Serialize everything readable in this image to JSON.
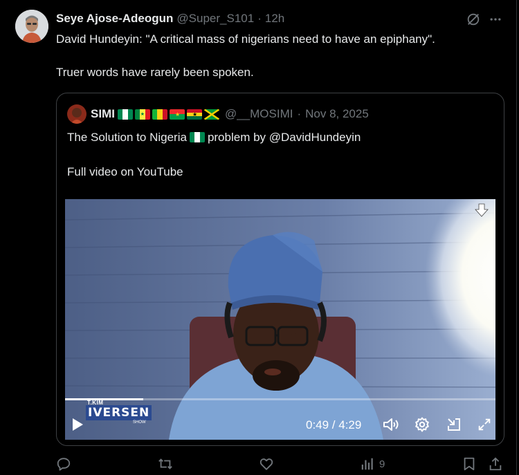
{
  "tweet": {
    "author_name": "Seye Ajose-Adeogun",
    "author_handle": "@Super_S101",
    "separator": "·",
    "timestamp": "12h",
    "text_line1": "David Hundeyin: \"A critical mass of nigerians need to have an epiphany\".",
    "text_line2": "Truer words have rarely been spoken."
  },
  "quoted": {
    "author_name": "SIMI",
    "flags": [
      "nigeria",
      "senegal",
      "mali",
      "burkina-faso",
      "ghana",
      "jamaica"
    ],
    "author_handle": "@__MOSIMI",
    "separator": "·",
    "timestamp": "Nov 8, 2025",
    "text_part1": "The Solution to Nigeria",
    "text_part2": "problem by @DavidHundeyin",
    "text_line2": "Full video on YouTube"
  },
  "video": {
    "current_time": "0:49",
    "duration": "4:29",
    "time_display": "0:49 / 4:29",
    "progress_fraction": 0.182,
    "watermark_small": "T.KIM",
    "watermark_main": "IVERSEN",
    "watermark_sub": "SHOW"
  },
  "actions": {
    "views_count": "9"
  },
  "icons": {
    "header_right": [
      "grok-icon",
      "more-icon"
    ],
    "video_controls": [
      "play-icon",
      "volume-icon",
      "settings-icon",
      "pip-icon",
      "fullscreen-icon",
      "download-icon"
    ],
    "action_bar": [
      "reply-icon",
      "retweet-icon",
      "like-icon",
      "views-icon",
      "bookmark-icon",
      "share-icon"
    ]
  },
  "colors": {
    "background": "#000000",
    "text_primary": "#e7e9ea",
    "text_secondary": "#71767b",
    "border": "#2f3336",
    "video_bg": "#5a6f95"
  }
}
